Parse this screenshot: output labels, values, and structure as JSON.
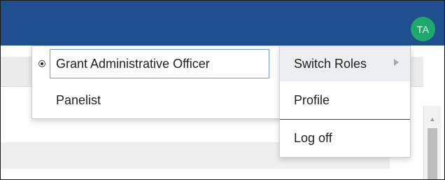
{
  "header": {
    "avatar_initials": "TA",
    "bar_color": "#1f4f8f",
    "avatar_color": "#1ea86a"
  },
  "roles_menu": {
    "items": [
      {
        "label": "Grant Administrative Officer",
        "selected": true
      },
      {
        "label": "Panelist",
        "selected": false
      }
    ]
  },
  "account_menu": {
    "items": [
      {
        "label": "Switch Roles",
        "has_submenu": true,
        "icon": "chevron-right-icon"
      },
      {
        "label": "Profile"
      },
      {
        "label": "Log off"
      }
    ]
  }
}
